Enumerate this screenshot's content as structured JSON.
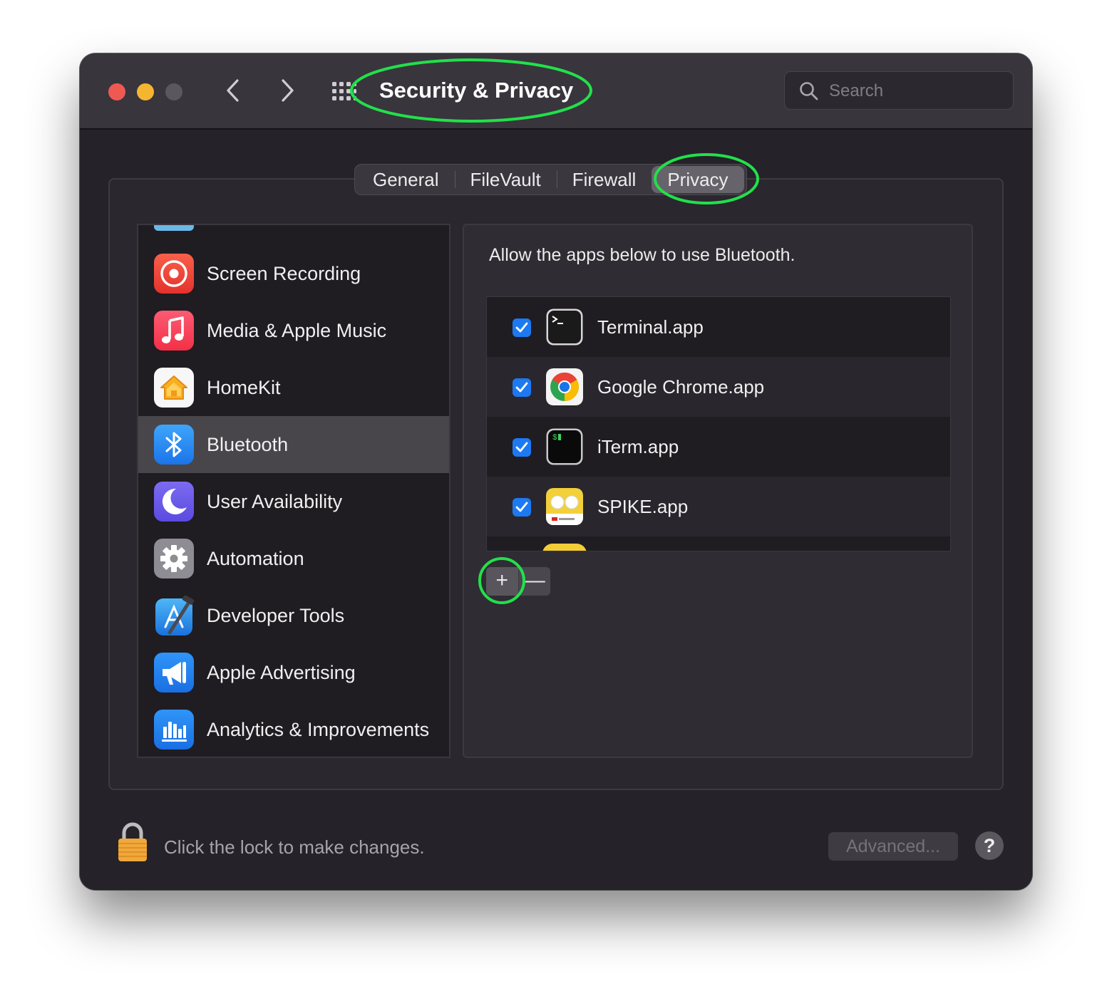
{
  "window": {
    "title": "Security & Privacy",
    "search": {
      "placeholder": "Search"
    }
  },
  "tabs": [
    {
      "label": "General",
      "selected": false
    },
    {
      "label": "FileVault",
      "selected": false
    },
    {
      "label": "Firewall",
      "selected": false
    },
    {
      "label": "Privacy",
      "selected": true
    }
  ],
  "sidebar": {
    "items": [
      {
        "label": "Screen Recording",
        "icon": "screen-recording-icon"
      },
      {
        "label": "Media & Apple Music",
        "icon": "music-note-icon"
      },
      {
        "label": "HomeKit",
        "icon": "home-icon"
      },
      {
        "label": "Bluetooth",
        "icon": "bluetooth-icon",
        "selected": true
      },
      {
        "label": "User Availability",
        "icon": "moon-icon"
      },
      {
        "label": "Automation",
        "icon": "gear-icon"
      },
      {
        "label": "Developer Tools",
        "icon": "developer-tools-icon"
      },
      {
        "label": "Apple Advertising",
        "icon": "megaphone-icon"
      },
      {
        "label": "Analytics & Improvements",
        "icon": "analytics-chart-icon"
      }
    ]
  },
  "detail": {
    "prompt": "Allow the apps below to use Bluetooth.",
    "apps": [
      {
        "name": "Terminal.app",
        "checked": true,
        "icon": "terminal-app-icon"
      },
      {
        "name": "Google Chrome.app",
        "checked": true,
        "icon": "chrome-app-icon"
      },
      {
        "name": "iTerm.app",
        "checked": true,
        "icon": "iterm-app-icon"
      },
      {
        "name": "SPIKE.app",
        "checked": true,
        "icon": "spike-app-icon"
      }
    ],
    "add_label": "+",
    "remove_label": "—"
  },
  "footer": {
    "lock_text": "Click the lock to make changes.",
    "advanced_label": "Advanced...",
    "help_label": "?"
  },
  "colors": {
    "accent": "#1c79f2",
    "annotation": "#22e04a",
    "window_bg": "#252229",
    "selected_row": "#48464b"
  }
}
